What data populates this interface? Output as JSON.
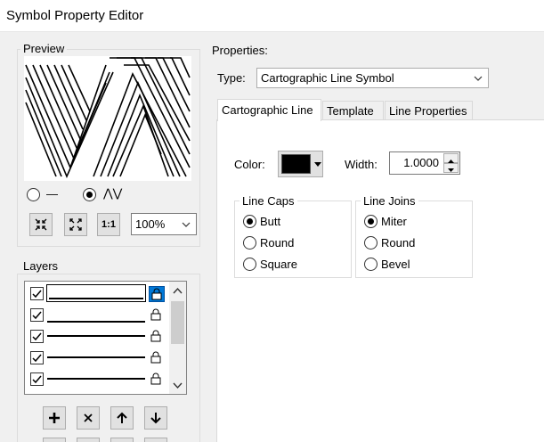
{
  "window": {
    "title": "Symbol Property Editor"
  },
  "preview": {
    "label": "Preview",
    "zoom_value": "100%"
  },
  "layers": {
    "label": "Layers",
    "rows": [
      {
        "checked": true,
        "selected": true
      },
      {
        "checked": true,
        "selected": false
      },
      {
        "checked": true,
        "selected": false
      },
      {
        "checked": true,
        "selected": false
      },
      {
        "checked": true,
        "selected": false
      }
    ]
  },
  "properties": {
    "label": "Properties:",
    "type_label": "Type:",
    "type_value": "Cartographic Line Symbol",
    "tabs": [
      {
        "label": "Cartographic Line",
        "active": true
      },
      {
        "label": "Template",
        "active": false
      },
      {
        "label": "Line Properties",
        "active": false
      }
    ],
    "color_label": "Color:",
    "color_value": "#000000",
    "width_label": "Width:",
    "width_value": "1.0000",
    "line_caps": {
      "label": "Line Caps",
      "options": [
        "Butt",
        "Round",
        "Square"
      ],
      "selected": "Butt"
    },
    "line_joins": {
      "label": "Line Joins",
      "options": [
        "Miter",
        "Round",
        "Bevel"
      ],
      "selected": "Miter"
    }
  },
  "colors": {
    "accent": "#0078d7",
    "window_bg": "#f0f0f0"
  }
}
